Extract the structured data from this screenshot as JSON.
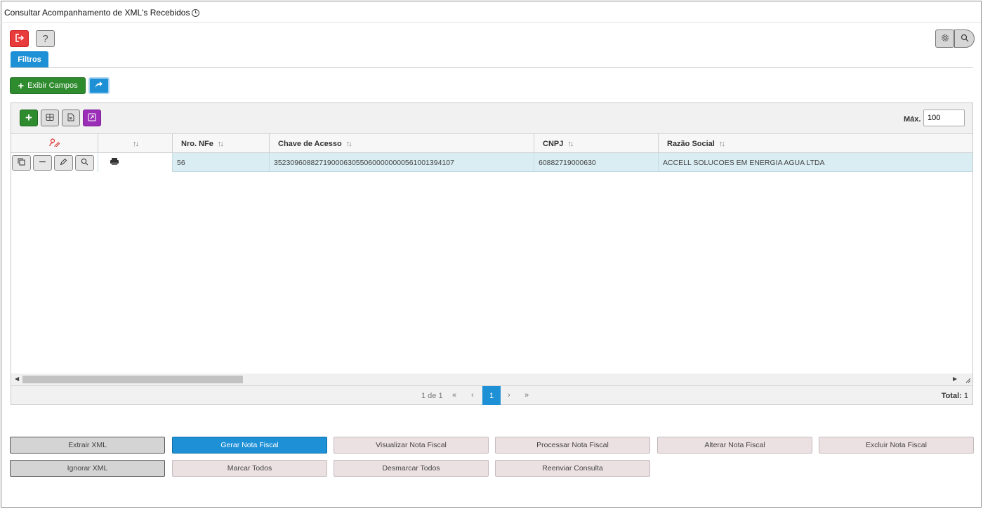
{
  "page": {
    "title": "Consultar Acompanhamento de XML's Recebidos"
  },
  "toolbar": {
    "help_label": "?"
  },
  "tabs": {
    "filtros": "Filtros"
  },
  "actions": {
    "exibir_campos": "Exibir Campos"
  },
  "grid": {
    "max_label": "Máx.",
    "max_value": "100",
    "columns": {
      "nro_nfe": "Nro. NFe",
      "chave_acesso": "Chave de Acesso",
      "cnpj": "CNPJ",
      "razao_social": "Razão Social"
    },
    "rows": [
      {
        "nro_nfe": "56",
        "chave_acesso": "35230960882719000630550600000000561001394107",
        "cnpj": "60882719000630",
        "razao_social": "ACCELL SOLUCOES EM ENERGIA AGUA LTDA"
      }
    ]
  },
  "pager": {
    "page_info": "1 de 1",
    "current_page": "1",
    "total_label": "Total:",
    "total_value": "1"
  },
  "bottom_buttons": {
    "extrair_xml": "Extrair XML",
    "gerar_nota": "Gerar Nota Fiscal",
    "visualizar_nota": "Visualizar Nota Fiscal",
    "processar_nota": "Processar Nota Fiscal",
    "alterar_nota": "Alterar Nota Fiscal",
    "excluir_nota": "Excluir Nota Fiscal",
    "ignorar_xml": "Ignorar XML",
    "marcar_todos": "Marcar Todos",
    "desmarcar_todos": "Desmarcar Todos",
    "reenviar_consulta": "Reenviar Consulta"
  },
  "colors": {
    "primary": "#1e90d6",
    "success": "#2e8b2e",
    "danger": "#e83b3b",
    "purple": "#9b2fb8",
    "row_selected": "#d9edf3"
  }
}
